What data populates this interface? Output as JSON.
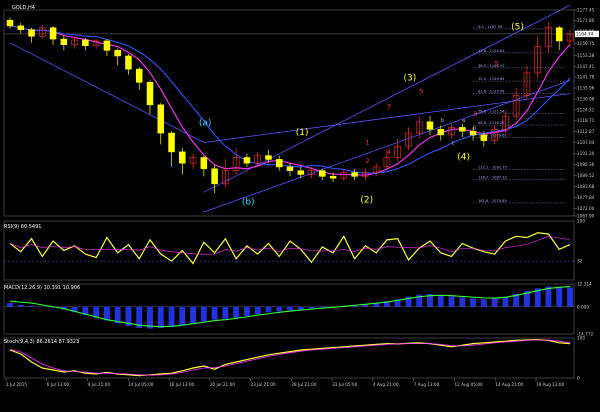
{
  "chart_data": {
    "type": "candlestick",
    "symbol_title": "GOLD,H4",
    "colors": {
      "bull": "#ff3030",
      "bear": "#ffff00",
      "ma_fast": "#ff33ff",
      "ma_slow": "#3355ff",
      "channel": "#5555ff",
      "wave_label": "#ffff33",
      "wave_label_alt": "#33ddff",
      "sub_label": "#ff3333",
      "fib": "#aaaaff",
      "grid": "#333333"
    },
    "price_axis": {
      "ticks": [
        "1177.45",
        "1171.80",
        "1165.96",
        "1159.75",
        "1153.28",
        "1147.41",
        "1141.78",
        "1135.96",
        "1130.08",
        "1124.31",
        "1118.71",
        "1112.87",
        "1107.04",
        "1101.20",
        "1095.36",
        "1089.52",
        "1083.68",
        "1077.84",
        "1072.00",
        "1067.90"
      ],
      "current_price": "1164.74",
      "ylim": [
        1067.9,
        1177.45
      ]
    },
    "time_axis": [
      "1 Jul 2015",
      "6 Jul 13:00",
      "9 Jul 21:00",
      "14 Jul 05:00",
      "16 Jul 13:00",
      "20 Jul 21:00",
      "23 Jul 21:00",
      "28 Jul 21:00",
      "31 Jul 05:00",
      "4 Aug 21:00",
      "7 Aug 13:00",
      "12 Aug 05:00",
      "14 Aug 21:00",
      "19 Aug 13:00"
    ],
    "main_series": [
      {
        "x": 0,
        "o": 1172.0,
        "c": 1169.0,
        "h": 1173.5,
        "l": 1167.5
      },
      {
        "x": 1,
        "o": 1169.0,
        "c": 1167.0,
        "h": 1170.5,
        "l": 1165.0
      },
      {
        "x": 2,
        "o": 1167.0,
        "c": 1163.5,
        "h": 1168.0,
        "l": 1160.0
      },
      {
        "x": 3,
        "o": 1163.5,
        "c": 1168.0,
        "h": 1169.5,
        "l": 1162.0
      },
      {
        "x": 4,
        "o": 1168.0,
        "c": 1162.0,
        "h": 1169.0,
        "l": 1159.0
      },
      {
        "x": 5,
        "o": 1162.0,
        "c": 1159.0,
        "h": 1164.0,
        "l": 1156.0
      },
      {
        "x": 6,
        "o": 1159.0,
        "c": 1161.5,
        "h": 1163.0,
        "l": 1157.0
      },
      {
        "x": 7,
        "o": 1161.5,
        "c": 1158.5,
        "h": 1162.5,
        "l": 1156.0
      },
      {
        "x": 8,
        "o": 1158.5,
        "c": 1161.0,
        "h": 1162.0,
        "l": 1157.0
      },
      {
        "x": 9,
        "o": 1161.0,
        "c": 1156.0,
        "h": 1162.0,
        "l": 1153.0
      },
      {
        "x": 10,
        "o": 1156.0,
        "c": 1153.0,
        "h": 1157.0,
        "l": 1148.0
      },
      {
        "x": 11,
        "o": 1153.0,
        "c": 1146.0,
        "h": 1154.0,
        "l": 1143.0
      },
      {
        "x": 12,
        "o": 1146.0,
        "c": 1139.0,
        "h": 1147.0,
        "l": 1135.0
      },
      {
        "x": 13,
        "o": 1139.0,
        "c": 1127.0,
        "h": 1140.0,
        "l": 1122.0
      },
      {
        "x": 14,
        "o": 1127.0,
        "c": 1112.0,
        "h": 1128.0,
        "l": 1106.0
      },
      {
        "x": 15,
        "o": 1112.0,
        "c": 1102.0,
        "h": 1113.0,
        "l": 1094.0
      },
      {
        "x": 16,
        "o": 1102.0,
        "c": 1096.0,
        "h": 1104.0,
        "l": 1090.0
      },
      {
        "x": 17,
        "o": 1096.0,
        "c": 1099.0,
        "h": 1101.0,
        "l": 1093.0
      },
      {
        "x": 18,
        "o": 1099.0,
        "c": 1093.0,
        "h": 1100.0,
        "l": 1089.0
      },
      {
        "x": 19,
        "o": 1093.0,
        "c": 1085.0,
        "h": 1095.0,
        "l": 1080.0
      },
      {
        "x": 20,
        "o": 1085.0,
        "c": 1092.0,
        "h": 1098.0,
        "l": 1083.0
      },
      {
        "x": 21,
        "o": 1092.0,
        "c": 1099.0,
        "h": 1104.0,
        "l": 1090.0
      },
      {
        "x": 22,
        "o": 1099.0,
        "c": 1096.0,
        "h": 1101.0,
        "l": 1094.0
      },
      {
        "x": 23,
        "o": 1096.0,
        "c": 1100.0,
        "h": 1102.0,
        "l": 1094.0
      },
      {
        "x": 24,
        "o": 1100.0,
        "c": 1098.0,
        "h": 1103.0,
        "l": 1096.0
      },
      {
        "x": 25,
        "o": 1098.0,
        "c": 1094.0,
        "h": 1100.0,
        "l": 1092.0
      },
      {
        "x": 26,
        "o": 1094.0,
        "c": 1092.0,
        "h": 1096.0,
        "l": 1089.0
      },
      {
        "x": 27,
        "o": 1092.0,
        "c": 1090.0,
        "h": 1094.0,
        "l": 1088.0
      },
      {
        "x": 28,
        "o": 1090.0,
        "c": 1092.0,
        "h": 1094.0,
        "l": 1088.0
      },
      {
        "x": 29,
        "o": 1092.0,
        "c": 1089.0,
        "h": 1093.0,
        "l": 1087.0
      },
      {
        "x": 30,
        "o": 1089.0,
        "c": 1088.0,
        "h": 1091.0,
        "l": 1086.0
      },
      {
        "x": 31,
        "o": 1088.0,
        "c": 1091.0,
        "h": 1093.0,
        "l": 1086.5
      },
      {
        "x": 32,
        "o": 1091.0,
        "c": 1089.0,
        "h": 1093.0,
        "l": 1087.0
      },
      {
        "x": 33,
        "o": 1089.0,
        "c": 1091.0,
        "h": 1093.0,
        "l": 1087.0
      },
      {
        "x": 34,
        "o": 1091.0,
        "c": 1094.0,
        "h": 1096.0,
        "l": 1089.0
      },
      {
        "x": 35,
        "o": 1094.0,
        "c": 1099.0,
        "h": 1103.0,
        "l": 1093.0
      },
      {
        "x": 36,
        "o": 1099.0,
        "c": 1105.0,
        "h": 1109.0,
        "l": 1097.0
      },
      {
        "x": 37,
        "o": 1105.0,
        "c": 1112.0,
        "h": 1115.0,
        "l": 1103.0
      },
      {
        "x": 38,
        "o": 1112.0,
        "c": 1118.0,
        "h": 1121.0,
        "l": 1109.0
      },
      {
        "x": 39,
        "o": 1118.0,
        "c": 1114.0,
        "h": 1121.0,
        "l": 1111.0
      },
      {
        "x": 40,
        "o": 1114.0,
        "c": 1111.0,
        "h": 1116.0,
        "l": 1108.0
      },
      {
        "x": 41,
        "o": 1111.0,
        "c": 1115.0,
        "h": 1117.0,
        "l": 1109.0
      },
      {
        "x": 42,
        "o": 1115.0,
        "c": 1113.0,
        "h": 1117.0,
        "l": 1110.0
      },
      {
        "x": 43,
        "o": 1113.0,
        "c": 1111.0,
        "h": 1115.0,
        "l": 1108.0
      },
      {
        "x": 44,
        "o": 1111.0,
        "c": 1108.0,
        "h": 1113.0,
        "l": 1105.0
      },
      {
        "x": 45,
        "o": 1108.0,
        "c": 1114.0,
        "h": 1116.0,
        "l": 1106.0
      },
      {
        "x": 46,
        "o": 1114.0,
        "c": 1121.0,
        "h": 1124.0,
        "l": 1112.0
      },
      {
        "x": 47,
        "o": 1121.0,
        "c": 1132.0,
        "h": 1136.0,
        "l": 1119.0
      },
      {
        "x": 48,
        "o": 1132.0,
        "c": 1144.0,
        "h": 1148.0,
        "l": 1130.0
      },
      {
        "x": 49,
        "o": 1144.0,
        "c": 1158.0,
        "h": 1163.0,
        "l": 1141.0
      },
      {
        "x": 50,
        "o": 1158.0,
        "c": 1168.0,
        "h": 1171.0,
        "l": 1155.0
      },
      {
        "x": 51,
        "o": 1168.0,
        "c": 1161.0,
        "h": 1169.0,
        "l": 1156.0
      },
      {
        "x": 52,
        "o": 1161.0,
        "c": 1164.7,
        "h": 1167.0,
        "l": 1158.0
      }
    ],
    "wave_labels": [
      {
        "text": "(a)",
        "x": 18,
        "price": 1116,
        "color": "alt"
      },
      {
        "text": "(b)",
        "x": 22,
        "price": 1074,
        "color": "alt"
      },
      {
        "text": "(1)",
        "x": 27,
        "price": 1111,
        "color": "main"
      },
      {
        "text": "(2)",
        "x": 33,
        "price": 1075,
        "color": "main"
      },
      {
        "text": "(3)",
        "x": 37,
        "price": 1140,
        "color": "main"
      },
      {
        "text": "(4)",
        "x": 42,
        "price": 1098,
        "color": "main"
      },
      {
        "text": "(5)",
        "x": 47,
        "price": 1167,
        "color": "main"
      }
    ],
    "sub_labels": [
      {
        "text": "1",
        "x": 33,
        "price": 1106
      },
      {
        "text": "2",
        "x": 33,
        "price": 1096
      },
      {
        "text": "3",
        "x": 35,
        "price": 1125
      },
      {
        "text": "4",
        "x": 35,
        "price": 1101
      },
      {
        "text": "5",
        "x": 38,
        "price": 1133
      },
      {
        "text": "5",
        "x": 45,
        "price": 1148
      },
      {
        "text": "3",
        "x": 43,
        "price": 1121
      },
      {
        "text": "a",
        "x": 40,
        "price": 1111
      },
      {
        "text": "b",
        "x": 40,
        "price": 1118
      },
      {
        "text": "c",
        "x": 41,
        "price": 1106
      },
      {
        "text": "a",
        "x": 42,
        "price": 1118
      },
      {
        "text": "b",
        "x": 43,
        "price": 1114
      }
    ],
    "fib_levels": [
      {
        "label": "0.0 - 1167.39",
        "price": 1167.39
      },
      {
        "label": "23.6 - 1154.63",
        "price": 1154.63
      },
      {
        "label": "38.2 - 1146.70",
        "price": 1146.7
      },
      {
        "label": "50.0 - 1139.64",
        "price": 1139.64
      },
      {
        "label": "61.8 - 1133.06",
        "price": 1133.06
      },
      {
        "label": "78.6 - 1122.54",
        "price": 1122.54
      },
      {
        "label": "88.6 - 1116.25",
        "price": 1116.25
      },
      {
        "label": "100.0 - 1109.62",
        "price": 1109.62
      },
      {
        "label": "127.2 - 1092.75",
        "price": 1092.75
      },
      {
        "label": "138.2 - 1087.32",
        "price": 1087.32
      },
      {
        "label": "161.8 - 1074.85",
        "price": 1074.85
      }
    ],
    "rsi": {
      "title": "RSI(9) 60.5491",
      "ticks": [
        "100",
        "32"
      ],
      "ylim": [
        0,
        100
      ],
      "values": [
        62,
        48,
        70,
        40,
        66,
        50,
        58,
        44,
        38,
        72,
        46,
        60,
        36,
        68,
        44,
        32,
        50,
        28,
        64,
        46,
        70,
        36,
        58,
        44,
        62,
        40,
        66,
        52,
        30,
        56,
        46,
        74,
        36,
        58,
        46,
        68,
        70,
        34,
        54,
        66,
        46,
        40,
        62,
        54,
        48,
        44,
        66,
        74,
        72,
        80,
        78,
        52,
        60
      ]
    },
    "macd": {
      "title": "MACD(12,26,9) 10.391 10.906",
      "ticks": [
        "12.314",
        "0.000",
        "-14.772"
      ],
      "ylim": [
        -14.772,
        12.314
      ],
      "hist": [
        2,
        1,
        0.5,
        0.2,
        -0.5,
        -1.5,
        -3,
        -4.5,
        -6,
        -7.5,
        -9,
        -10.5,
        -11.5,
        -11.8,
        -11.5,
        -11,
        -10,
        -9,
        -8,
        -7,
        -6.5,
        -6,
        -5,
        -4,
        -3,
        -2.5,
        -2,
        -1.5,
        -1,
        -0.5,
        0,
        0.5,
        1,
        1.5,
        2,
        3,
        4,
        5.5,
        6.5,
        7,
        6.5,
        5.5,
        5,
        4.5,
        4,
        4.5,
        5.5,
        7,
        8.5,
        10,
        11,
        10.5,
        10.4
      ],
      "signal": [
        3,
        2.5,
        2,
        1,
        0,
        -1,
        -2.5,
        -4,
        -5.5,
        -7,
        -8,
        -9,
        -10,
        -10.5,
        -10.8,
        -10.6,
        -10,
        -9.2,
        -8.4,
        -7.5,
        -7,
        -6.3,
        -5.5,
        -4.5,
        -3.8,
        -3,
        -2.4,
        -1.8,
        -1.3,
        -0.8,
        -0.3,
        0.2,
        0.8,
        1.3,
        1.9,
        2.6,
        3.5,
        4.5,
        5.4,
        6,
        6.2,
        6,
        5.6,
        5.2,
        4.8,
        4.7,
        5.1,
        6.1,
        7.4,
        8.7,
        9.9,
        10.5,
        10.9
      ]
    },
    "stoch": {
      "title": "Stoch(9,4,3) 86.2614 87.9323",
      "ticks": [
        "100",
        "0"
      ],
      "ylim": [
        0,
        100
      ],
      "k": [
        70,
        60,
        40,
        25,
        20,
        15,
        18,
        12,
        10,
        14,
        10,
        8,
        6,
        8,
        10,
        12,
        18,
        25,
        30,
        22,
        34,
        40,
        46,
        52,
        58,
        62,
        66,
        70,
        72,
        74,
        76,
        78,
        80,
        82,
        84,
        86,
        85,
        87,
        88,
        86,
        82,
        78,
        82,
        86,
        88,
        90,
        92,
        94,
        95,
        96,
        94,
        88,
        86
      ],
      "d": [
        72,
        65,
        50,
        35,
        25,
        18,
        16,
        15,
        12,
        12,
        11,
        10,
        8,
        7,
        8,
        10,
        14,
        20,
        25,
        26,
        30,
        36,
        42,
        48,
        54,
        59,
        63,
        67,
        70,
        72,
        74,
        76,
        78,
        80,
        82,
        84,
        85,
        86,
        86,
        86,
        84,
        81,
        80,
        82,
        85,
        88,
        90,
        92,
        94,
        95,
        95,
        92,
        88
      ]
    }
  }
}
